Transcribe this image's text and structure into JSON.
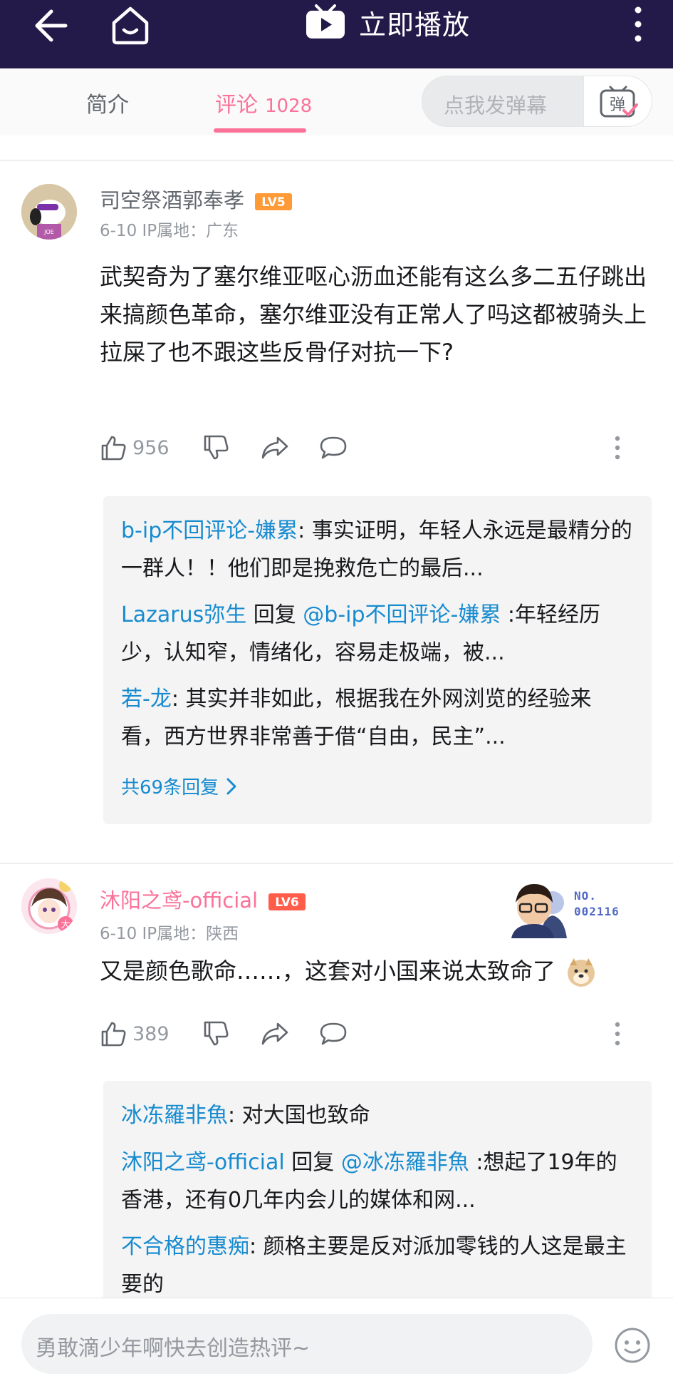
{
  "topbar": {
    "play_label": "立即播放",
    "bg_color": "#241a49"
  },
  "tabs": {
    "intro_label": "简介",
    "comments_label": "评论",
    "comments_count": "1028",
    "danmaku_placeholder": "点我发弹幕",
    "danmaku_button_glyph": "弹",
    "accent_color": "#fb7299"
  },
  "comments": [
    {
      "username": "司空祭酒郭奉孝",
      "level": "LV5",
      "meta": "6-10  IP属地：广东",
      "text": "武契奇为了塞尔维亚呕心沥血还能有这么多二五仔跳出来搞颜色革命，塞尔维亚没有正常人了吗这都被骑头上拉屎了也不跟这些反骨仔对抗一下?",
      "likes": "956",
      "replies": [
        {
          "name": "b-ip不回评论-嫌累",
          "sep": ": ",
          "text": "事实证明，年轻人永远是最精分的一群人！！他们即是挽救危亡的最后..."
        },
        {
          "name": "Lazarus弥生",
          "reply_word": " 回复 ",
          "at": "@b-ip不回评论-嫌累",
          "text": " :年轻经历少，认知窄，情绪化，容易走极端，被..."
        },
        {
          "name": "若-龙",
          "sep": ": ",
          "text": "其实并非如此，根据我在外网浏览的经验来看，西方世界非常善于借“自由，民主”..."
        }
      ],
      "more_replies": "共69条回复"
    },
    {
      "username": "沐阳之鸢-official",
      "level": "LV6",
      "meta": "6-10  IP属地：陕西",
      "text": "又是颜色歌命……，这套对小国来说太致命了",
      "likes": "389",
      "fan_no_line1": "NO.",
      "fan_no_line2": "002116",
      "replies": [
        {
          "name": "冰冻羅非魚",
          "sep": ": ",
          "text": "对大国也致命"
        },
        {
          "name": "沐阳之鸢-official",
          "reply_word": " 回复 ",
          "at": "@冰冻羅非魚",
          "text": " :想起了19年的香港，还有0几年内会儿的媒体和网..."
        },
        {
          "name": "不合格的惠痴",
          "sep": ": ",
          "text": "颜格主要是反对派加零钱的人这是最主要的"
        }
      ]
    }
  ],
  "bottom": {
    "input_placeholder": "勇敢滴少年啊快去创造热评~"
  }
}
